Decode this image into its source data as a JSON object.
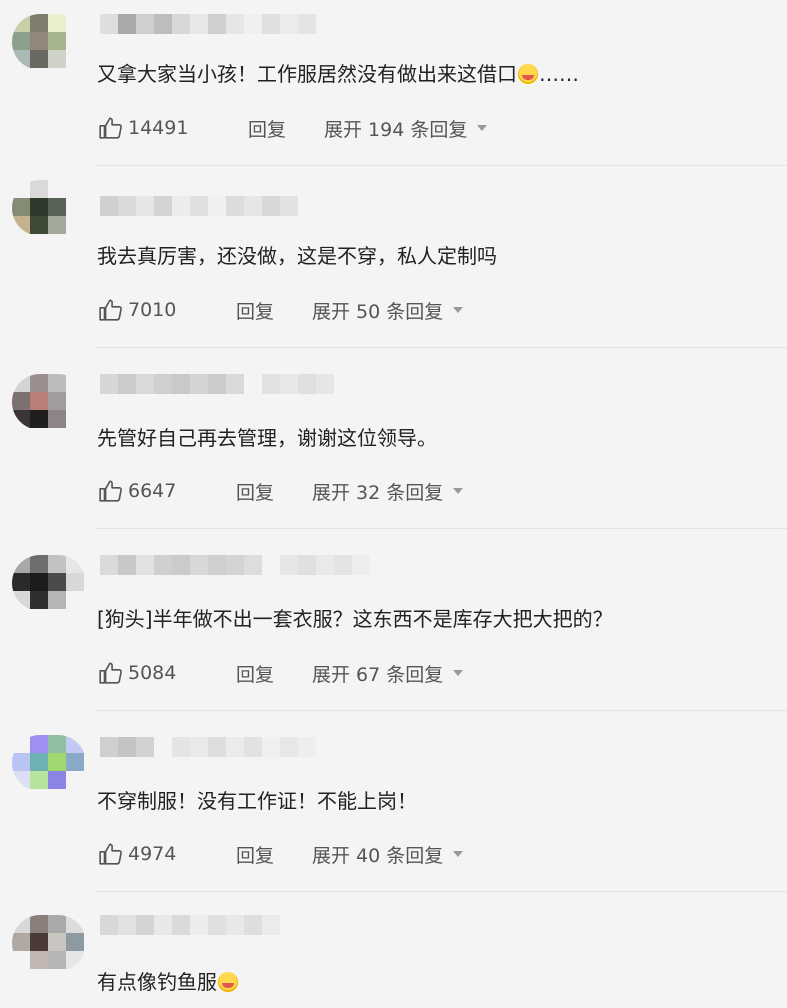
{
  "comments": [
    {
      "text": "又拿大家当小孩！工作服居然没有做出来这借口",
      "trailing_emoji": "laugh-cry-emoji",
      "suffix": "……",
      "likes": "14491",
      "reply_label": "回复",
      "expand_label": "展开 194 条回复"
    },
    {
      "text": "我去真厉害，还没做，这是不穿，私人定制吗",
      "likes": "7010",
      "reply_label": "回复",
      "expand_label": "展开 50 条回复"
    },
    {
      "text": "先管好自己再去管理，谢谢这位领导。",
      "likes": "6647",
      "reply_label": "回复",
      "expand_label": "展开 32 条回复"
    },
    {
      "text": "[狗头]半年做不出一套衣服？这东西不是库存大把大把的？",
      "likes": "5084",
      "reply_label": "回复",
      "expand_label": "展开 67 条回复"
    },
    {
      "text": "不穿制服！没有工作证！不能上岗！",
      "likes": "4974",
      "reply_label": "回复",
      "expand_label": "展开 40 条回复"
    },
    {
      "text": "有点像钓鱼服",
      "trailing_emoji": "laugh-cry-emoji"
    }
  ],
  "colors": {
    "background": "#f4f4f4",
    "text": "#222222",
    "meta": "#555555"
  },
  "icons": {
    "like": "thumbs-up-icon",
    "expand": "chevron-down-icon"
  }
}
